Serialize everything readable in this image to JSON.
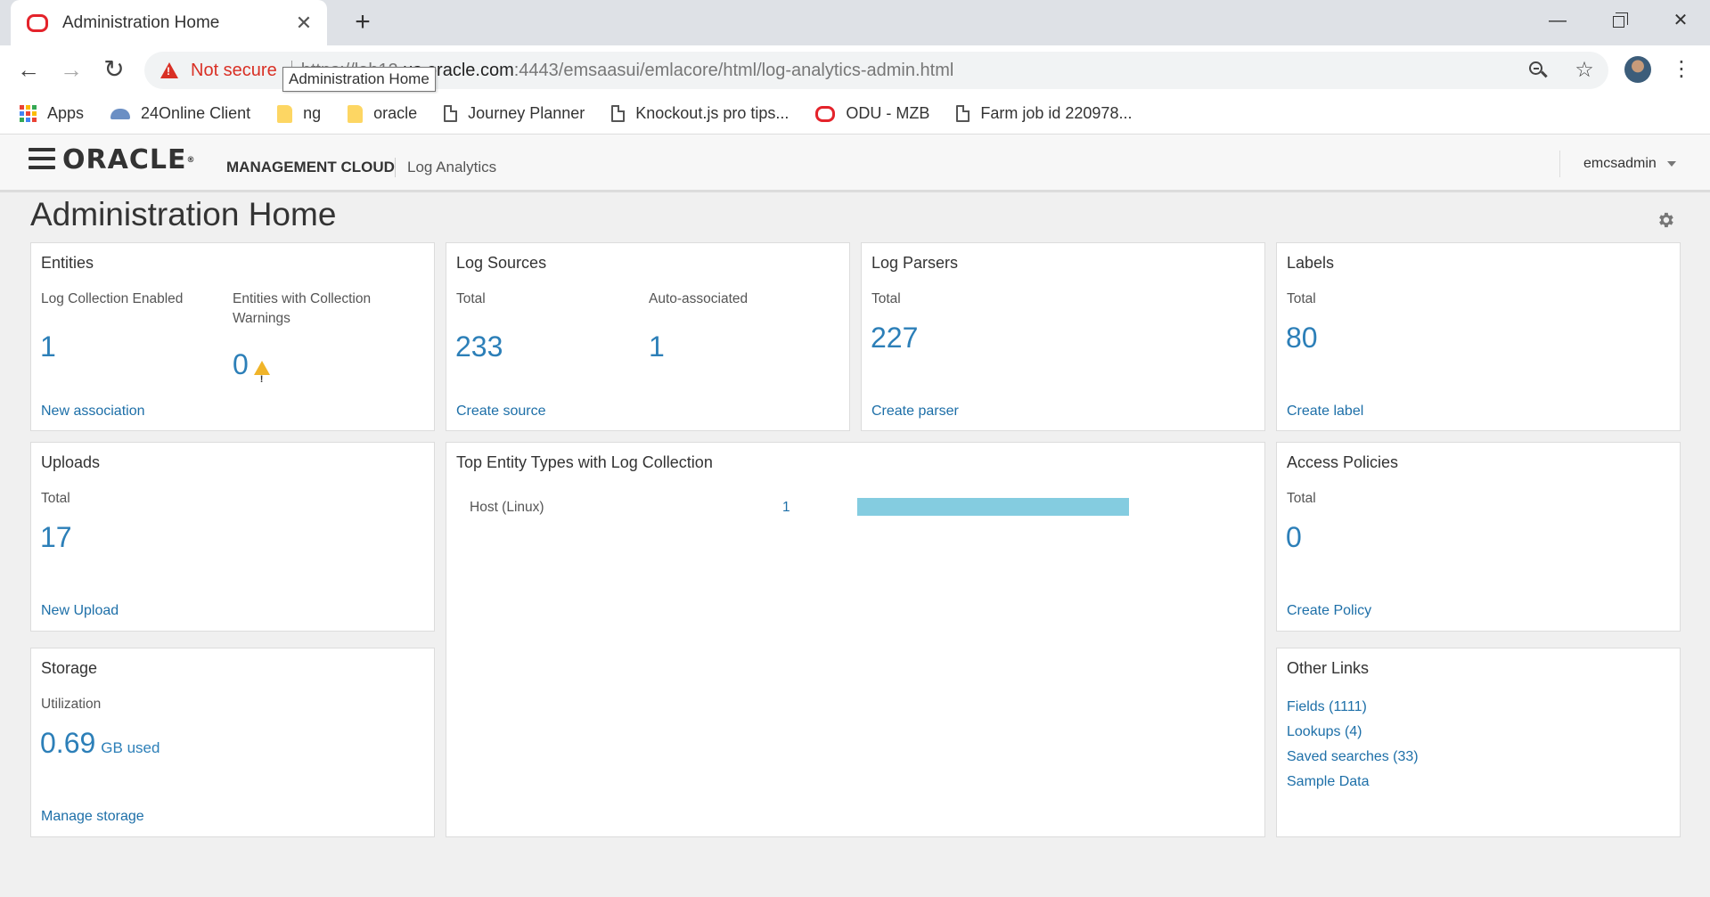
{
  "browser": {
    "tab_title": "Administration Home",
    "new_tab": "+",
    "not_secure": "Not secure",
    "url_prefix": "https://lah12.",
    "url_host": "us.oracle.com",
    "url_path": ":4443/emsaasui/emlacore/html/log-analytics-admin.html",
    "tooltip": "Administration Home",
    "bookmarks": [
      {
        "label": "Apps",
        "icon": "apps-grid-icon"
      },
      {
        "label": "24Online Client",
        "icon": "cloud-icon"
      },
      {
        "label": "ng",
        "icon": "folder-icon"
      },
      {
        "label": "oracle",
        "icon": "folder-icon"
      },
      {
        "label": "Journey Planner",
        "icon": "page-icon"
      },
      {
        "label": "Knockout.js pro tips...",
        "icon": "page-icon"
      },
      {
        "label": "ODU - MZB",
        "icon": "oracle-o-icon"
      },
      {
        "label": "Farm job id 220978...",
        "icon": "page-icon"
      }
    ]
  },
  "header": {
    "logo": "ORACLE",
    "product": "MANAGEMENT CLOUD",
    "app": "Log Analytics",
    "user": "emcsadmin"
  },
  "page": {
    "title": "Administration Home"
  },
  "cards": {
    "entities": {
      "title": "Entities",
      "enabled_label": "Log Collection Enabled",
      "enabled_value": "1",
      "warnings_label": "Entities with Collection Warnings",
      "warnings_value": "0",
      "link": "New association"
    },
    "sources": {
      "title": "Log Sources",
      "total_label": "Total",
      "total_value": "233",
      "auto_label": "Auto-associated",
      "auto_value": "1",
      "link": "Create source"
    },
    "parsers": {
      "title": "Log Parsers",
      "total_label": "Total",
      "total_value": "227",
      "link": "Create parser"
    },
    "labels": {
      "title": "Labels",
      "total_label": "Total",
      "total_value": "80",
      "link": "Create label"
    },
    "uploads": {
      "title": "Uploads",
      "total_label": "Total",
      "total_value": "17",
      "link": "New Upload"
    },
    "top_entities": {
      "title": "Top Entity Types with Log Collection",
      "rows": [
        {
          "label": "Host (Linux)",
          "count": "1",
          "fraction": 0.82
        }
      ]
    },
    "access": {
      "title": "Access Policies",
      "total_label": "Total",
      "total_value": "0",
      "link": "Create Policy"
    },
    "storage": {
      "title": "Storage",
      "util_label": "Utilization",
      "util_value": "0.69",
      "util_unit": "GB used",
      "link": "Manage storage"
    },
    "other": {
      "title": "Other Links",
      "links": [
        "Fields (1111)",
        "Lookups (4)",
        "Saved searches (33)",
        "Sample Data"
      ]
    }
  },
  "colors": {
    "accent": "#2c7fb8",
    "link": "#1d6fa8",
    "bar": "#84cce0",
    "warning": "#f0b429",
    "insecure": "#d93025"
  }
}
